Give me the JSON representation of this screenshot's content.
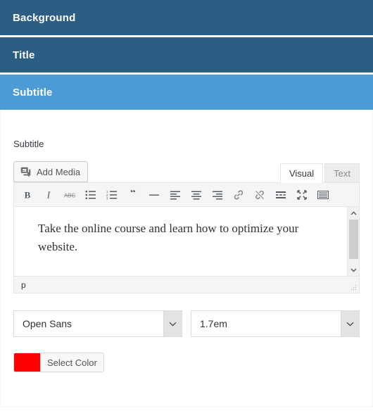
{
  "accordion": {
    "sections": [
      {
        "label": "Background",
        "state": "collapsed"
      },
      {
        "label": "Title",
        "state": "collapsed"
      },
      {
        "label": "Subtitle",
        "state": "active"
      }
    ]
  },
  "panel": {
    "field_label": "Subtitle",
    "add_media": {
      "label": "Add Media",
      "icon": "admin-media-icon"
    },
    "editor_tabs": [
      {
        "label": "Visual",
        "active": true
      },
      {
        "label": "Text",
        "active": false
      }
    ],
    "toolbar": [
      {
        "name": "bold",
        "title": "B"
      },
      {
        "name": "italic",
        "title": "I"
      },
      {
        "name": "strikethrough",
        "title": "ABC"
      },
      {
        "name": "bullet-list",
        "title": "Unordered list"
      },
      {
        "name": "numbered-list",
        "title": "Ordered list"
      },
      {
        "name": "blockquote",
        "title": "Blockquote"
      },
      {
        "name": "horizontal-rule",
        "title": "Horizontal line"
      },
      {
        "name": "align-left",
        "title": "Align left"
      },
      {
        "name": "align-center",
        "title": "Align center"
      },
      {
        "name": "align-right",
        "title": "Align right"
      },
      {
        "name": "insert-link",
        "title": "Insert link"
      },
      {
        "name": "remove-link",
        "title": "Remove link"
      },
      {
        "name": "read-more",
        "title": "Insert Read More tag"
      },
      {
        "name": "fullscreen",
        "title": "Distraction-free writing mode"
      },
      {
        "name": "toolbar-toggle",
        "title": "Toolbar Toggle"
      }
    ],
    "editor_content": "Take the online course and learn how to optimize your website.",
    "status_path": "p",
    "font_select": {
      "value": "Open Sans"
    },
    "size_select": {
      "value": "1.7em"
    },
    "color_picker": {
      "label": "Select Color",
      "color": "#ff0000"
    }
  },
  "colors": {
    "panel_collapsed": "#2c5d82",
    "panel_active": "#4a9bd6",
    "accent_red": "#ff0000"
  }
}
